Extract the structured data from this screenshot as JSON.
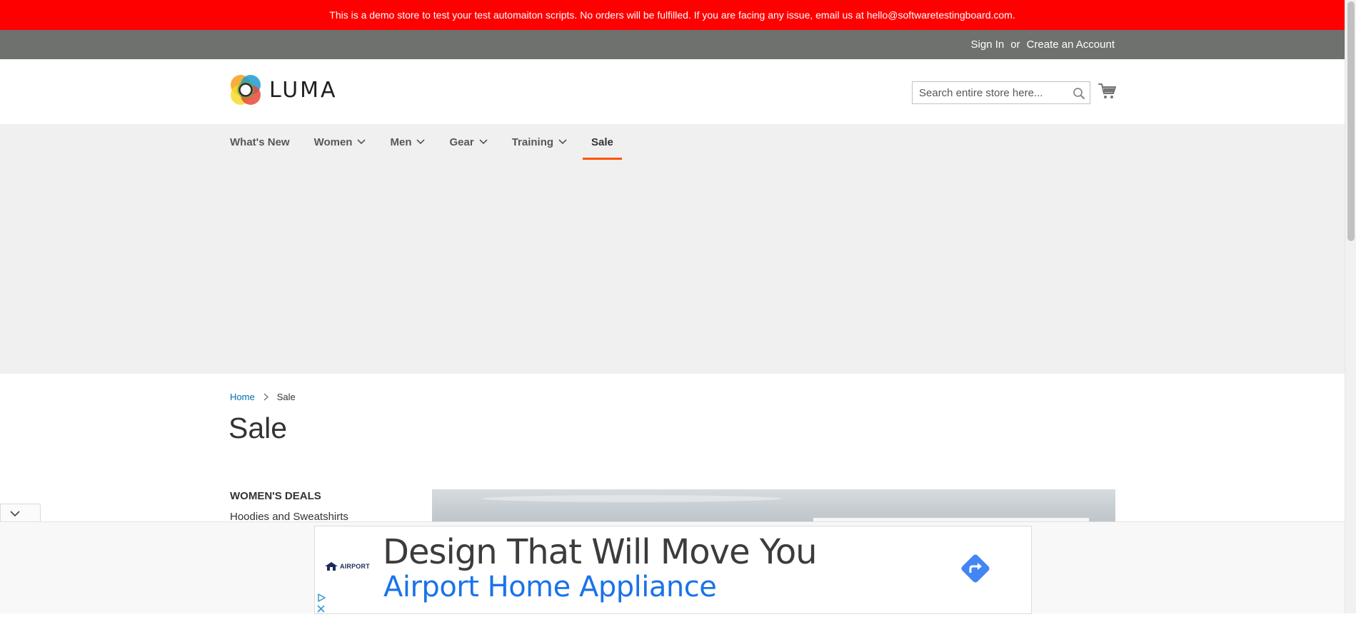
{
  "notice": {
    "text": "This is a demo store to test your test automaiton scripts. No orders will be fulfilled. If you are facing any issue, email us at hello@softwaretestingboard.com."
  },
  "panel": {
    "sign_in": "Sign In",
    "or": "or",
    "create_account": "Create an Account"
  },
  "header": {
    "logo_text": "LUMA",
    "search_placeholder": "Search entire store here..."
  },
  "nav": {
    "items": [
      {
        "label": "What's New",
        "has_dropdown": false
      },
      {
        "label": "Women",
        "has_dropdown": true
      },
      {
        "label": "Men",
        "has_dropdown": true
      },
      {
        "label": "Gear",
        "has_dropdown": true
      },
      {
        "label": "Training",
        "has_dropdown": true
      },
      {
        "label": "Sale",
        "has_dropdown": false,
        "active": true
      }
    ]
  },
  "breadcrumbs": {
    "home": "Home",
    "current": "Sale"
  },
  "page": {
    "title": "Sale"
  },
  "sidebar": {
    "title": "WOMEN'S DEALS",
    "first_link": "Hoodies and Sweatshirts"
  },
  "ad": {
    "logo_name": "AIRPORT",
    "headline": "Design That Will Move You",
    "advertiser": "Airport Home Appliance"
  },
  "colors": {
    "notice_bg": "#ff0000",
    "panel_bg": "#6e716e",
    "nav_bg": "#f0f0f0",
    "active_underline": "#ff5501",
    "link": "#006bb4",
    "ad_blue": "#1a73e8"
  }
}
